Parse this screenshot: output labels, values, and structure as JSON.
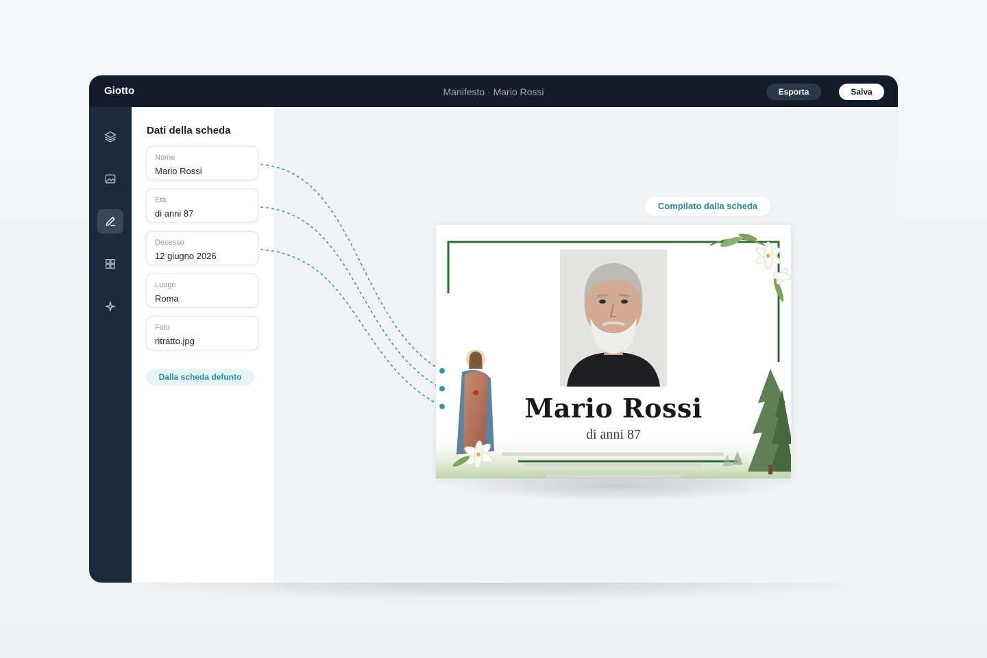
{
  "app": {
    "name": "Giotto",
    "document_title": "Manifesto · Mario Rossi",
    "actions": {
      "export_label": "Esporta",
      "save_label": "Salva"
    }
  },
  "rail": {
    "items": [
      {
        "icon": "layers-icon",
        "active": false
      },
      {
        "icon": "image-icon",
        "active": false
      },
      {
        "icon": "pen-icon",
        "active": true
      },
      {
        "icon": "grid-icon",
        "active": false
      },
      {
        "icon": "sparkle-icon",
        "active": false
      }
    ]
  },
  "panel": {
    "title": "Dati della scheda",
    "fields": [
      {
        "label": "Nome",
        "value": "Mario Rossi"
      },
      {
        "label": "Età",
        "value": "di anni 87"
      },
      {
        "label": "Decesso",
        "value": "12 giugno 2026"
      },
      {
        "label": "Luogo",
        "value": "Roma"
      },
      {
        "label": "Foto",
        "value": "ritratto.jpg"
      }
    ],
    "source_chip": "Dalla scheda defunto"
  },
  "canvas": {
    "filled_chip": "Compilato dalla scheda",
    "manifesto": {
      "name": "Mario Rossi",
      "age": "di anni 87"
    }
  },
  "colors": {
    "topbar": "#121c2b",
    "rail": "#1d2a3b",
    "accent_teal": "#2b8a93",
    "frame_green": "#2f6b3a"
  }
}
